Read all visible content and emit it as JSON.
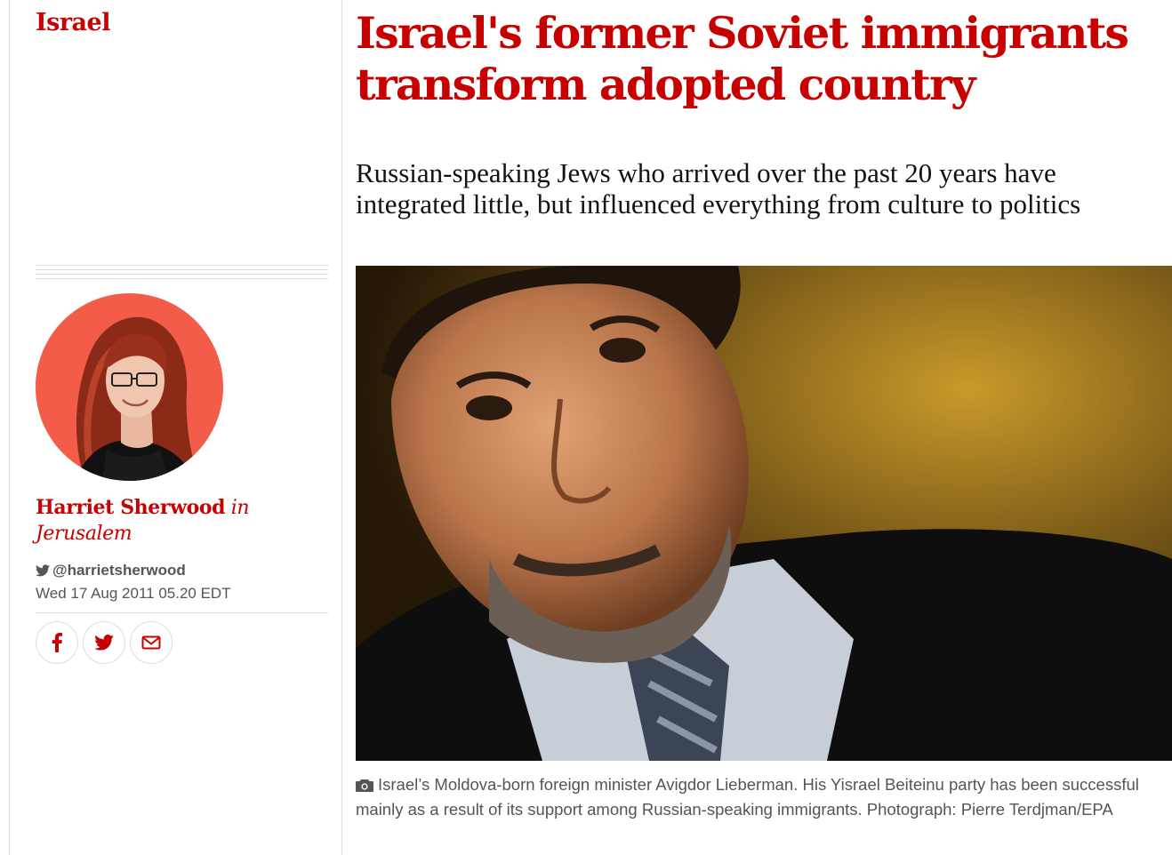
{
  "section": {
    "label": "Israel"
  },
  "article": {
    "headline": "Israel's former Soviet immigrants transform adopted country",
    "standfirst": "Russian-speaking Jews who arrived over the past 20 years have integrated little, but influenced everything from culture to politics"
  },
  "byline": {
    "author": "Harriet Sherwood",
    "location": "in Jerusalem",
    "twitter": "@harrietsherwood",
    "date": "Wed 17 Aug 2011 05.20 EDT"
  },
  "share": {
    "icons": [
      "facebook-icon",
      "twitter-icon",
      "email-icon"
    ]
  },
  "caption": {
    "text": "Israel’s Moldova-born foreign minister Avigdor Lieberman. His Yisrael Beiteinu party has been successful mainly as a result of its support among Russian-speaking immigrants. Photograph: Pierre Terdjman/EPA"
  },
  "colors": {
    "accent": "#c70000",
    "avatar_bg": "#f25c48",
    "rule": "#dcdcdc",
    "meta_text": "#555555"
  }
}
